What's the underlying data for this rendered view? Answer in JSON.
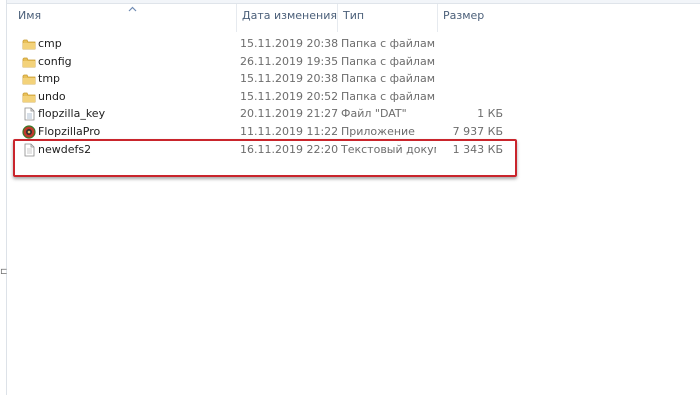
{
  "columns": {
    "name": "Имя",
    "date": "Дата изменения",
    "type": "Тип",
    "size": "Размер"
  },
  "files": [
    {
      "name": "cmp",
      "date": "15.11.2019 20:38",
      "type": "Папка с файлами",
      "size": "",
      "icon": "folder-icon"
    },
    {
      "name": "config",
      "date": "26.11.2019 19:35",
      "type": "Папка с файлами",
      "size": "",
      "icon": "folder-icon"
    },
    {
      "name": "tmp",
      "date": "15.11.2019 20:38",
      "type": "Папка с файлами",
      "size": "",
      "icon": "folder-icon"
    },
    {
      "name": "undo",
      "date": "15.11.2019 20:52",
      "type": "Папка с файлами",
      "size": "",
      "icon": "folder-icon"
    },
    {
      "name": "flopzilla_key",
      "date": "20.11.2019 21:27",
      "type": "Файл \"DAT\"",
      "size": "1 КБ",
      "icon": "dat-file-icon"
    },
    {
      "name": "FlopzillaPro",
      "date": "11.11.2019 11:22",
      "type": "Приложение",
      "size": "7 937 КБ",
      "icon": "application-icon"
    },
    {
      "name": "newdefs2",
      "date": "16.11.2019 22:20",
      "type": "Текстовый докум...",
      "size": "1 343 КБ",
      "icon": "text-file-icon"
    }
  ],
  "colors": {
    "highlight_border": "#c9252c",
    "header_text": "#4c607a",
    "folder": "#e8c05a"
  }
}
